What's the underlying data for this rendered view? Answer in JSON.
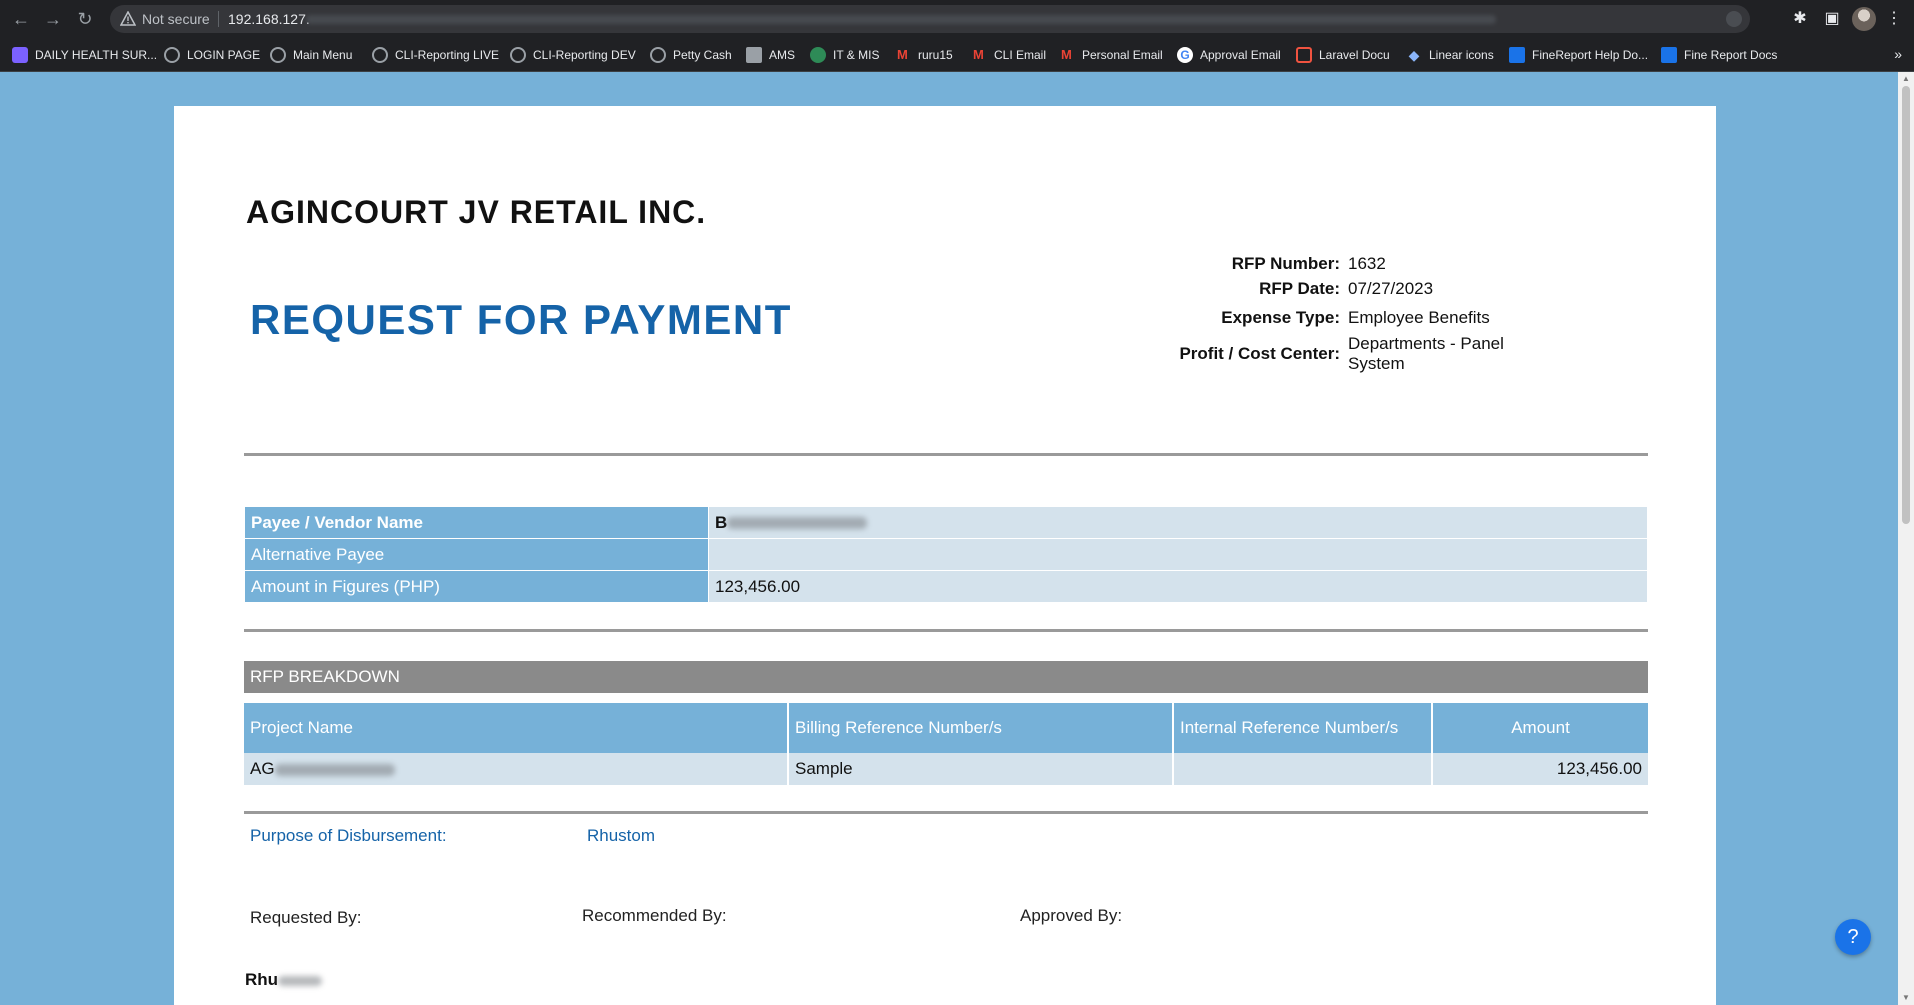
{
  "browser": {
    "security_label": "Not secure",
    "url_visible": "192.168.127.",
    "bookmarks": [
      {
        "label": "DAILY HEALTH SUR...",
        "icon": "checklist-icon",
        "color": "#7b61ff"
      },
      {
        "label": "LOGIN PAGE",
        "icon": "globe-icon",
        "color": "#9aa0a6"
      },
      {
        "label": "Main Menu",
        "icon": "globe-icon",
        "color": "#9aa0a6"
      },
      {
        "label": "CLI-Reporting LIVE",
        "icon": "globe-icon",
        "color": "#9aa0a6"
      },
      {
        "label": "CLI-Reporting DEV",
        "icon": "globe-icon",
        "color": "#9aa0a6"
      },
      {
        "label": "Petty Cash",
        "icon": "globe-icon",
        "color": "#9aa0a6"
      },
      {
        "label": "AMS",
        "icon": "screen-icon",
        "color": "#9aa0a6"
      },
      {
        "label": "IT & MIS",
        "icon": "seal-icon",
        "color": "#2e8b57"
      },
      {
        "label": "ruru15",
        "icon": "gmail-icon",
        "color": "#ea4335"
      },
      {
        "label": "CLI Email",
        "icon": "gmail-icon",
        "color": "#ea4335"
      },
      {
        "label": "Personal Email",
        "icon": "gmail-icon",
        "color": "#ea4335"
      },
      {
        "label": "Approval Email",
        "icon": "google-icon",
        "color": "#4285f4"
      },
      {
        "label": "Laravel Docu",
        "icon": "laravel-icon",
        "color": "#f05340"
      },
      {
        "label": "Linear icons",
        "icon": "diamond-icon",
        "color": "#8ab4f8"
      },
      {
        "label": "FineReport Help Do...",
        "icon": "finereport-icon",
        "color": "#1a73e8"
      },
      {
        "label": "Fine Report Docs",
        "icon": "finereport-icon",
        "color": "#1a73e8"
      }
    ],
    "more_label": "»"
  },
  "document": {
    "company": "AGINCOURT JV RETAIL INC.",
    "title": "REQUEST FOR PAYMENT",
    "meta": {
      "rfp_number_label": "RFP Number:",
      "rfp_number": "1632",
      "rfp_date_label": "RFP Date:",
      "rfp_date": "07/27/2023",
      "expense_type_label": "Expense Type:",
      "expense_type": "Employee Benefits",
      "cost_center_label": "Profit / Cost Center:",
      "cost_center": "Departments - Panel System"
    },
    "payee": {
      "vendor_label": "Payee / Vendor Name",
      "vendor_value_visible": "B",
      "alt_payee_label": "Alternative Payee",
      "alt_payee_value": "",
      "amount_label": "Amount in Figures (PHP)",
      "amount_value": "123,456.00"
    },
    "breakdown": {
      "section_title": "RFP BREAKDOWN",
      "headers": [
        "Project Name",
        "Billing Reference Number/s",
        "Internal Reference Number/s",
        "Amount"
      ],
      "rows": [
        {
          "project_visible": "AG",
          "billing_ref": "Sample",
          "internal_ref": "",
          "amount": "123,456.00"
        }
      ]
    },
    "purpose_label": "Purpose of Disbursement:",
    "purpose_value": "Rhustom",
    "signatures": {
      "requested_label": "Requested By:",
      "recommended_label": "Recommended By:",
      "approved_label": "Approved By:",
      "requester_visible": "Rhu"
    }
  },
  "help_label": "?",
  "colors": {
    "page_bg": "#76b1d8",
    "title_blue": "#1563a8",
    "label_cell": "#76b1d8",
    "value_cell": "#d4e2ec",
    "section_gray": "#8a8a8a"
  }
}
